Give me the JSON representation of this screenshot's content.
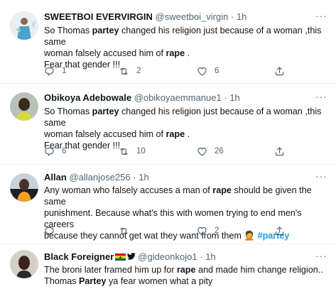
{
  "tweets": [
    {
      "name": "SWEETBOI EVERVIRGIN",
      "handle": "@sweetboi_virgin",
      "dot": "·",
      "time": "1h",
      "lines": [
        [
          "So Thomas ",
          "partey",
          " changed his religion just because of a woman ,this same"
        ],
        [
          "woman falsely accused him of ",
          "rape",
          " ."
        ],
        [
          "Fear that gender !!!"
        ]
      ],
      "replies": "1",
      "retweets": "2",
      "likes": "6"
    },
    {
      "name": "Obikoya Adebowale",
      "handle": "@obikoyaemmanue1",
      "dot": "·",
      "time": "1h",
      "lines": [
        [
          "So Thomas ",
          "partey",
          " changed his religion just because of a woman ,this same"
        ],
        [
          "woman falsely accused him of ",
          "rape",
          " ."
        ],
        [
          "Fear that gender !!!"
        ]
      ],
      "replies": "6",
      "retweets": "10",
      "likes": "26"
    },
    {
      "name": "Allan",
      "handle": "@allanjose256",
      "dot": "·",
      "time": "1h",
      "line1a": "Any woman who falsely accuses a man of ",
      "line1b": "rape",
      "line1c": " should be given the same",
      "line2": "punishment. Because what's this with women trying to end men's careers",
      "line3": "because they cannot get wat they want from them",
      "emoji": "🤦",
      "hashtag": "#partey",
      "replies": "",
      "retweets": "",
      "likes": "2"
    },
    {
      "name": "Black Foreigner",
      "handle": "@gideonkojo1",
      "dot": "·",
      "time": "1h",
      "line1a": "The broni later framed him up for ",
      "line1b": "rape",
      "line1c": " and made him change religion..",
      "line2a": "Thomas ",
      "line2b": "Partey",
      "line2c": " ya fear women what a pity"
    }
  ],
  "more_label": "···",
  "colors": {
    "link": "#1d9bf0",
    "muted": "#536471",
    "divider": "#eff3f4"
  },
  "icons": [
    "reply-icon",
    "retweet-icon",
    "like-icon",
    "share-icon",
    "more-icon",
    "verified-icon",
    "ghana-flag-icon"
  ]
}
